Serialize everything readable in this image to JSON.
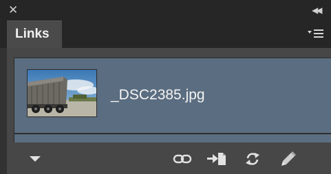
{
  "window": {
    "close_icon": "close-icon",
    "collapse_icon": "double-chevron-left-icon"
  },
  "panel": {
    "tab_label": "Links",
    "menu_icon": "panel-menu-icon"
  },
  "links": [
    {
      "filename": "_DSC2385.jpg",
      "thumbnail": "dump-truck-photo"
    }
  ],
  "toolbar": {
    "items": [
      {
        "name": "show-link-info",
        "icon": "triangle-down-icon"
      },
      {
        "name": "relink",
        "icon": "chain-link-icon"
      },
      {
        "name": "go-to-link",
        "icon": "go-to-link-icon"
      },
      {
        "name": "update-link",
        "icon": "refresh-icon"
      },
      {
        "name": "edit-original",
        "icon": "pencil-icon"
      }
    ]
  },
  "colors": {
    "selection": "#5b6d80",
    "panel_bg": "#474747",
    "chrome_bg": "#262626"
  }
}
